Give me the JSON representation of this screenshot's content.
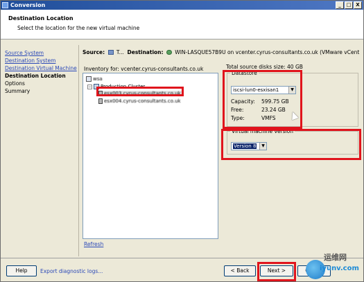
{
  "window": {
    "title": "Conversion",
    "controls": [
      "_",
      "□",
      "X"
    ]
  },
  "header": {
    "title": "Destination Location",
    "subtitle": "Select the location for the new virtual machine"
  },
  "steps": [
    {
      "label": "Source System",
      "state": "link"
    },
    {
      "label": "Destination System",
      "state": "link"
    },
    {
      "label": "Destination Virtual Machine",
      "state": "link"
    },
    {
      "label": "Destination Location",
      "state": "current"
    },
    {
      "label": "Options",
      "state": "plain"
    },
    {
      "label": "Summary",
      "state": "plain"
    }
  ],
  "summary": {
    "source_label": "Source:",
    "source_value": "T...",
    "destination_label": "Destination:",
    "destination_value": "WIN-LASQUE57B9U on vcenter.cyrus-consultants.co.uk (VMware vCent..."
  },
  "inventory": {
    "label": "Inventory for:  vcenter.cyrus-consultants.co.uk",
    "root": "wsa",
    "cluster": "Production Cluster",
    "hosts": [
      "esx003.cyrus-consultants.co.uk",
      "esx004.cyrus-consultants.co.uk"
    ],
    "selected_host_index": 0
  },
  "refresh_label": "Refresh",
  "total_disk": "Total source disks size:  40 GB",
  "datastore": {
    "legend": "Datastore",
    "selected": "iscsi-lun0-esxisan1",
    "capacity_label": "Capacity:",
    "capacity": "599.75 GB",
    "free_label": "Free:",
    "free": "23.24 GB",
    "type_label": "Type:",
    "type": "VMFS"
  },
  "vm_version": {
    "legend": "Virtual machine version",
    "selected": "Version 8"
  },
  "footer": {
    "help": "Help",
    "export_logs": "Export diagnostic logs...",
    "back": "< Back",
    "next": "Next >",
    "cancel": "Cancel"
  },
  "watermark": {
    "cn": "运维网",
    "en": "iyunv.com"
  },
  "colors": {
    "highlight": "#e0141c",
    "link": "#2a48b8",
    "titlebar": "#1f4d9a"
  }
}
